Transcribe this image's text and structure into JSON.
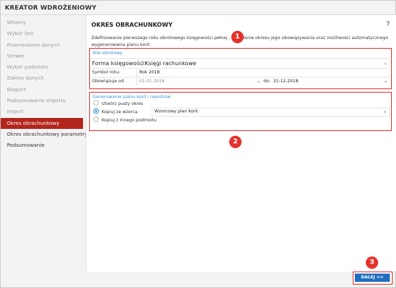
{
  "app": {
    "title": "KREATOR WDROŻENIOWY"
  },
  "sidebar": {
    "items": [
      {
        "label": "Witamy"
      },
      {
        "label": "Wybór linii"
      },
      {
        "label": "Przeniesienie danych"
      },
      {
        "label": "Serwer"
      },
      {
        "label": "Wybór podmiotu"
      },
      {
        "label": "Zakres danych"
      },
      {
        "label": "Eksport"
      },
      {
        "label": "Podsumowanie importu"
      },
      {
        "label": "Import"
      },
      {
        "label": "Okres obrachunkowy"
      },
      {
        "label": "Okres obrachunkowy parametry"
      },
      {
        "label": "Podsumowanie"
      }
    ],
    "active_index": 9
  },
  "main": {
    "title": "OKRES OBRACHUNKOWY",
    "help": "?",
    "description": "Zdefiniowanie pierwszego roku obrotowego księgowości pełnej - określenie okresu jego obowiązywania oraz możliwości automatycznego wygenerowania planu kont."
  },
  "rok_obrotowy": {
    "header": "Rok obrotowy",
    "forma_label": "Forma księgowości:",
    "forma_value": "Księgi rachunkowe",
    "symbol_label": "Symbol roku:",
    "symbol_value": "Rok 2018",
    "od_label": "Obowiązuje od",
    "od_value": "01-01-2018",
    "do_label": "do:",
    "do_value": "31-12-2018"
  },
  "generowanie": {
    "header": "Generowanie planu kont i rejestrów",
    "options": [
      {
        "label": "Utwórz pusty okres",
        "selected": false
      },
      {
        "label": "Kopiuj ze wzorca",
        "selected": true
      },
      {
        "label": "Kopiuj z innego podmiotu",
        "selected": false
      }
    ],
    "wzorzec_value": "Wzorcowy plan kont"
  },
  "callouts": [
    "1",
    "2",
    "3"
  ],
  "footer": {
    "next_label": "DALEJ >>"
  },
  "colors": {
    "accent_red": "#b3261e",
    "highlight_red": "#e52121",
    "button_blue": "#1e6fc0",
    "link_blue": "#3a8fd0"
  }
}
